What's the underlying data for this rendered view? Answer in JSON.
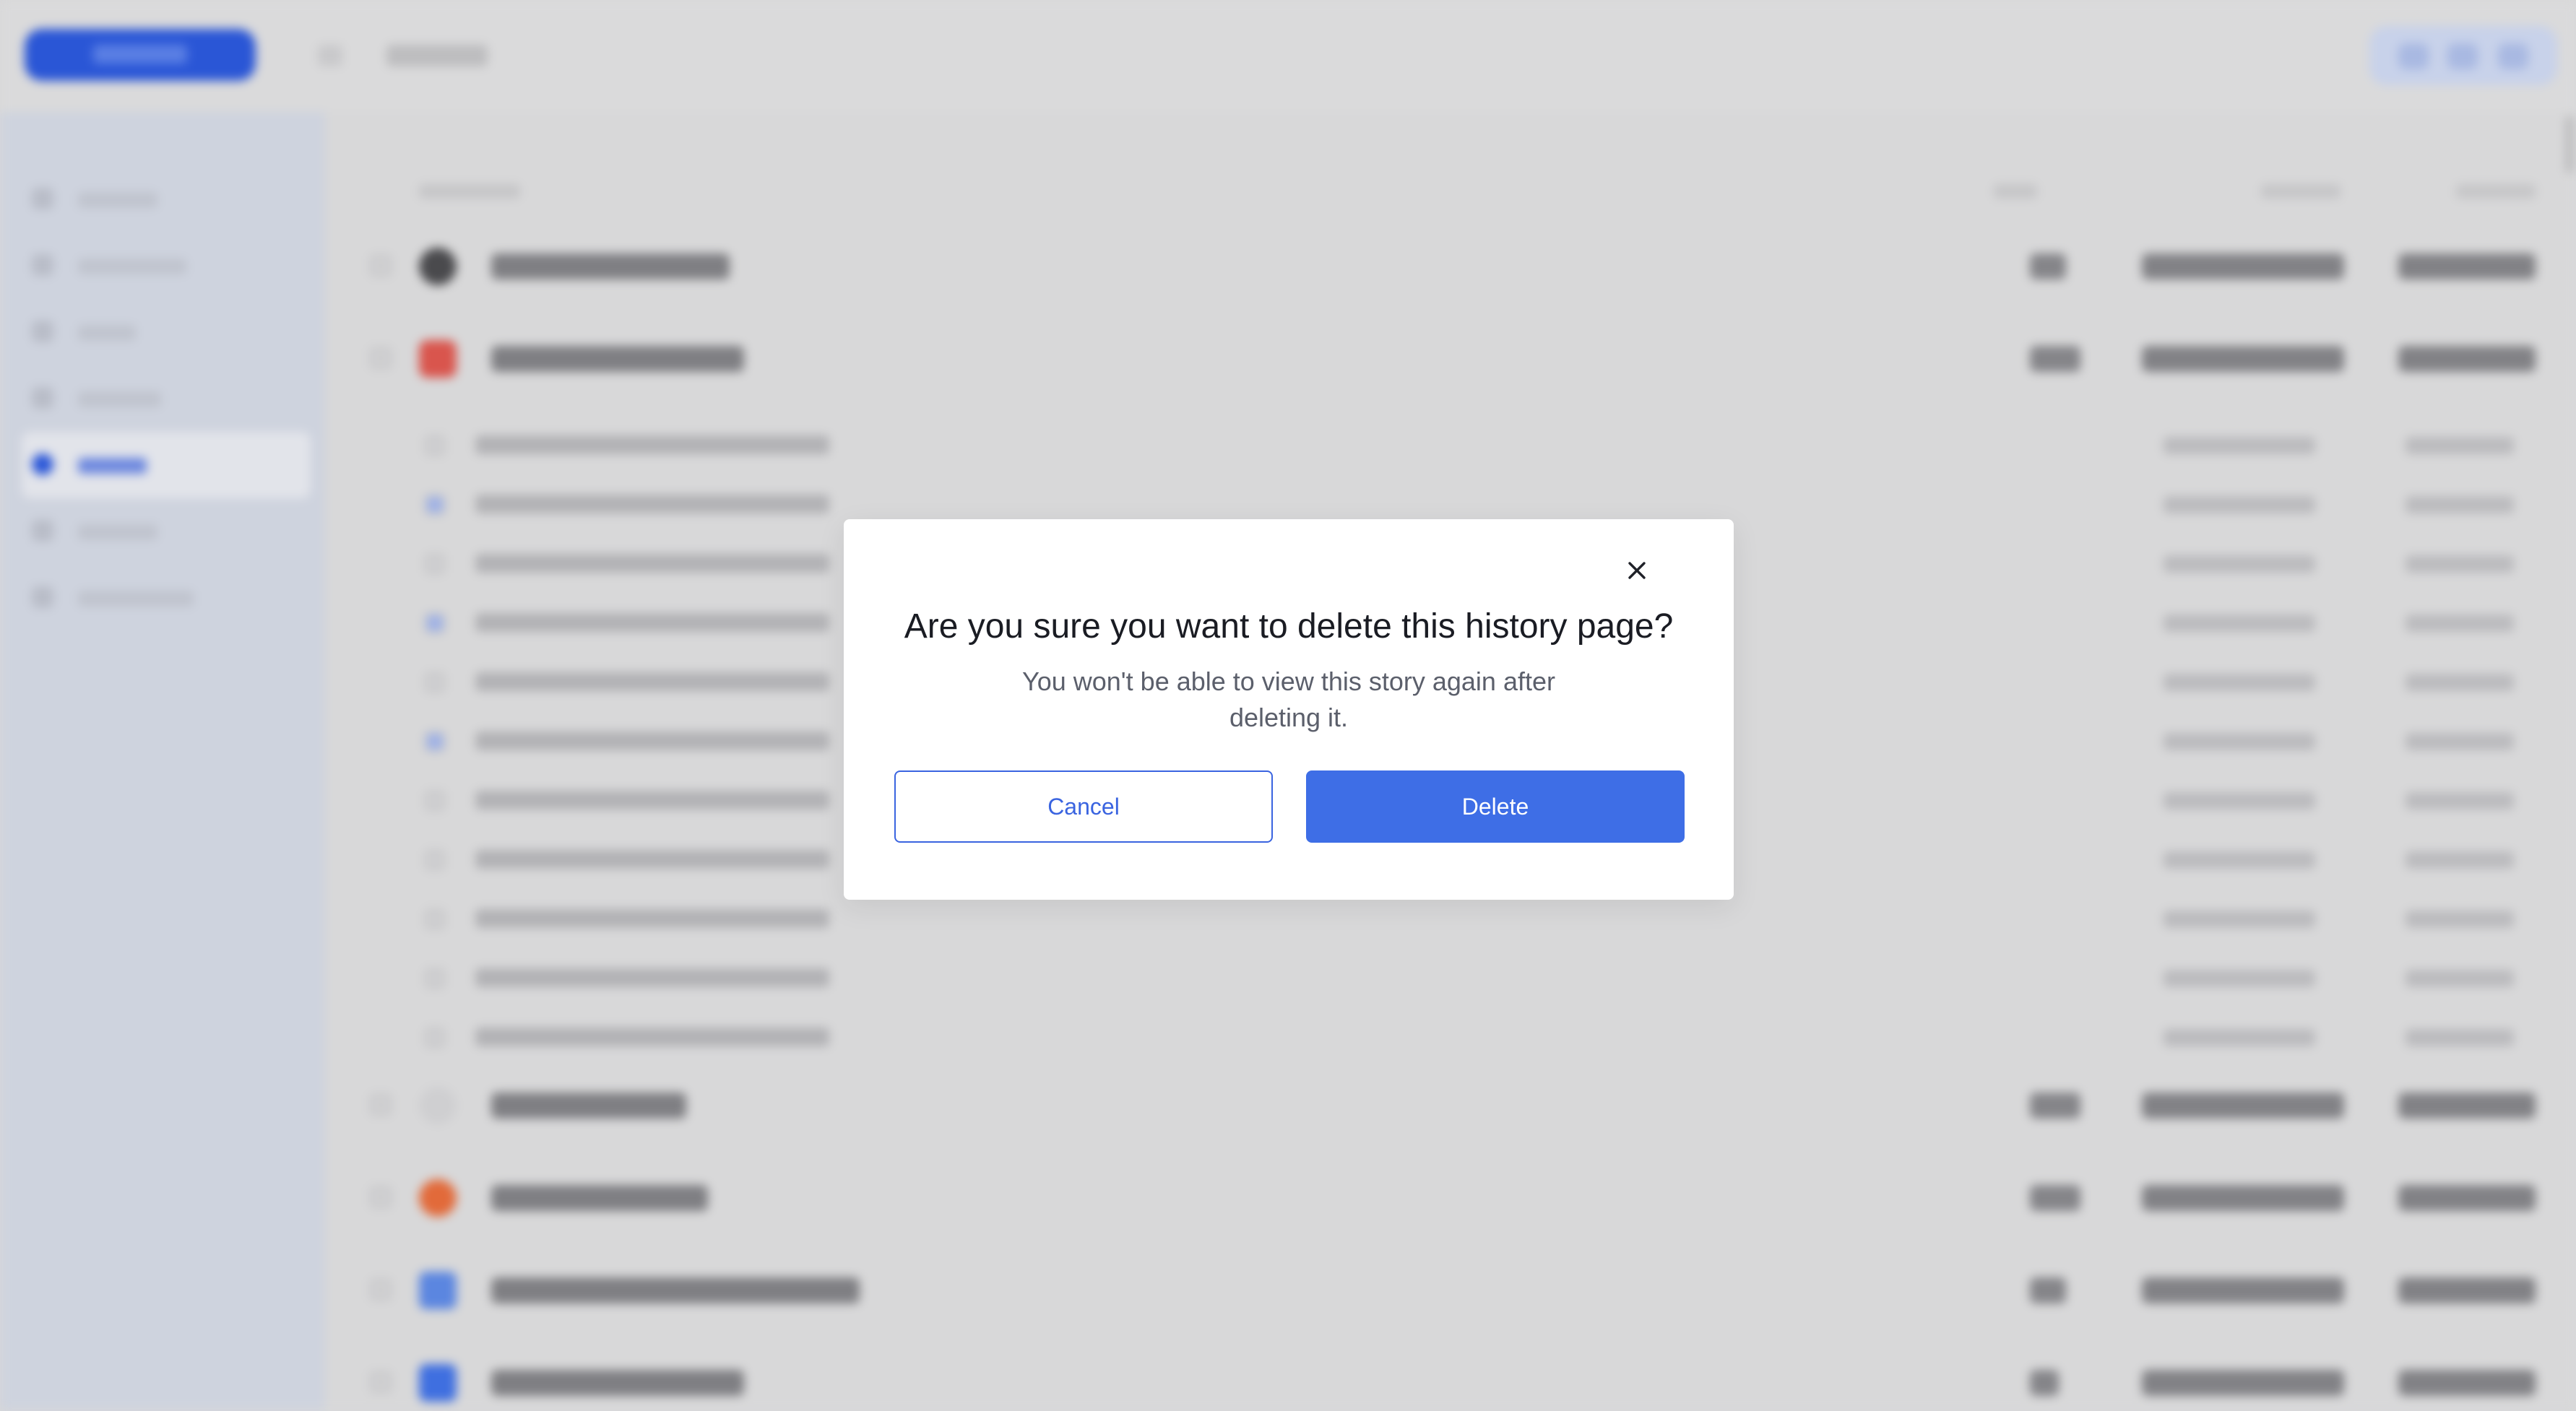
{
  "modal": {
    "title": "Are you sure you want to delete this history page?",
    "description": "You won't be able to view this story again after deleting it.",
    "cancel_label": "Cancel",
    "delete_label": "Delete",
    "close_icon": "close-icon"
  },
  "colors": {
    "primary": "#3e6ee6",
    "overlay": "#d8d8d9",
    "sidebar": "#ced3de"
  }
}
